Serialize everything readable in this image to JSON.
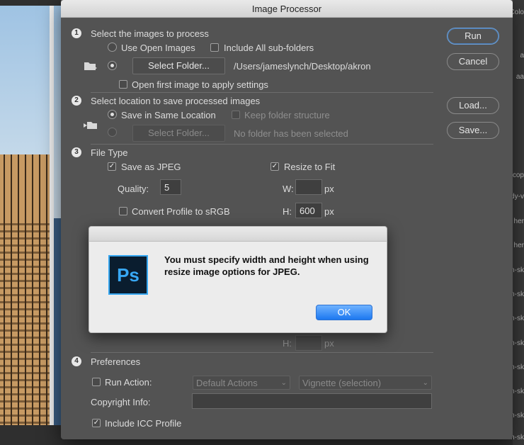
{
  "dialog": {
    "title": "Image Processor",
    "buttons": {
      "run": "Run",
      "cancel": "Cancel",
      "load": "Load...",
      "save": "Save..."
    },
    "section1": {
      "number": "1",
      "title": "Select the images to process",
      "use_open_images": "Use Open Images",
      "include_subfolders": "Include All sub-folders",
      "select_folder": "Select Folder...",
      "folder_path": "/Users/jameslynch/Desktop/akron",
      "open_first_image": "Open first image to apply settings"
    },
    "section2": {
      "number": "2",
      "title": "Select location to save processed images",
      "save_same_location": "Save in Same Location",
      "keep_folder_structure": "Keep folder structure",
      "select_folder": "Select Folder...",
      "no_folder": "No folder has been selected"
    },
    "section3": {
      "number": "3",
      "title": "File Type",
      "save_as_jpeg": "Save as JPEG",
      "resize_to_fit": "Resize to Fit",
      "quality_label": "Quality:",
      "quality_value": "5",
      "w_label": "W:",
      "w_value": "",
      "h_label": "H:",
      "h_value": "600",
      "unit": "px",
      "convert_profile": "Convert Profile to sRGB",
      "hidden_h_label": "H:",
      "hidden_unit": "px"
    },
    "section4": {
      "number": "4",
      "title": "Preferences",
      "run_action": "Run Action:",
      "action_set": "Default Actions",
      "action": "Vignette (selection)",
      "copyright_label": "Copyright Info:",
      "copyright_value": "",
      "include_icc": "Include ICC Profile"
    }
  },
  "alert": {
    "icon_text": "Ps",
    "message": "You must specify width and height when using resize image options for JPEG.",
    "ok": "OK"
  },
  "background": {
    "right_labels": [
      "Colo",
      "a",
      "aa",
      "cop",
      "dy-v",
      "her",
      "her",
      "n-sk",
      "n-sk",
      "n-sk",
      "n-sk",
      "n-sk",
      "n-sk",
      "n-sk",
      "n-sk"
    ]
  },
  "colors": {
    "dialog_bg": "#535353",
    "accent": "#1c78f0",
    "ps_blue": "#38a8f5"
  }
}
